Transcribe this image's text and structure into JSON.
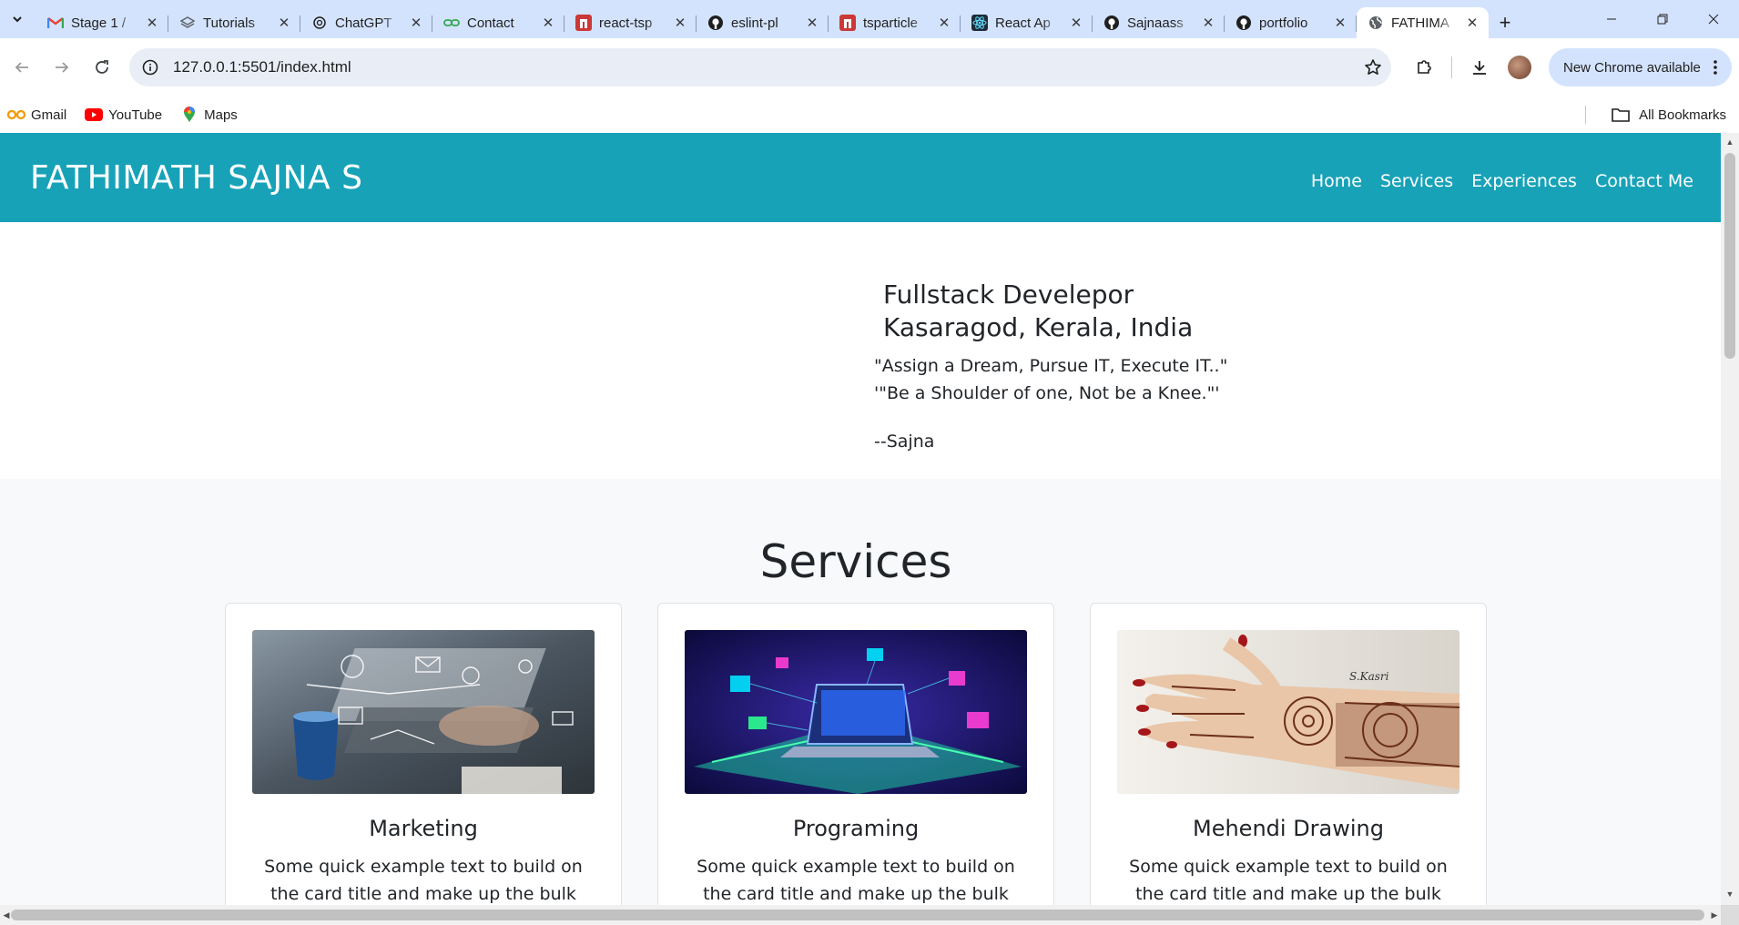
{
  "tabs": [
    {
      "title": "Stage 1 /",
      "icon": "gmail-icon",
      "color": "#ea4335"
    },
    {
      "title": "Tutorials",
      "icon": "layers-icon",
      "color": "#5f6368"
    },
    {
      "title": "ChatGPT",
      "icon": "chatgpt-icon",
      "color": "#1f1f1f"
    },
    {
      "title": "Contact",
      "icon": "link-icon",
      "color": "#34a853"
    },
    {
      "title": "react-tsp",
      "icon": "npm-icon",
      "color": "#cb3837"
    },
    {
      "title": "eslint-pl",
      "icon": "github-icon",
      "color": "#1f1f1f"
    },
    {
      "title": "tsparticle",
      "icon": "npm-icon",
      "color": "#cb3837"
    },
    {
      "title": "React Ap",
      "icon": "react-icon",
      "color": "#1d2b3a"
    },
    {
      "title": "Sajnaass",
      "icon": "github-icon",
      "color": "#1f1f1f"
    },
    {
      "title": "portfolio",
      "icon": "github-icon",
      "color": "#1f1f1f"
    },
    {
      "title": "FATHIMA",
      "icon": "globe-icon",
      "color": "#5f6368",
      "active": true
    }
  ],
  "toolbar": {
    "url": "127.0.0.1:5501/index.html",
    "update_label": "New Chrome available"
  },
  "bookmarks": {
    "items": [
      {
        "label": "Gmail",
        "icon": "gmail-bookmark-icon"
      },
      {
        "label": "YouTube",
        "icon": "youtube-icon"
      },
      {
        "label": "Maps",
        "icon": "maps-icon"
      }
    ],
    "all_label": "All Bookmarks"
  },
  "site": {
    "brand": "FATHIMATH SAJNA S",
    "nav": [
      "Home",
      "Services",
      "Experiences",
      "Contact Me"
    ],
    "hero": {
      "line1": "Fullstack Develepor",
      "line2": "Kasaragod, Kerala, India",
      "quote1": "\"Assign a Dream, Pursue IT, Execute IT..\"",
      "quote2": "'\"Be a Shoulder of one, Not be a Knee.\"'",
      "signature": "--Sajna"
    },
    "services": {
      "heading": "Services",
      "cards": [
        {
          "title": "Marketing",
          "text": "Some quick example text to build on the card title and make up the bulk",
          "image": "marketing-image"
        },
        {
          "title": "Programing",
          "text": "Some quick example text to build on the card title and make up the bulk",
          "image": "programming-image"
        },
        {
          "title": "Mehendi Drawing",
          "text": "Some quick example text to build on the card title and make up the bulk",
          "image": "mehendi-image"
        }
      ]
    }
  },
  "colors": {
    "navbar": "#17a2b8",
    "tabstrip": "#d3e3fd",
    "section_bg": "#f8f9fa"
  }
}
